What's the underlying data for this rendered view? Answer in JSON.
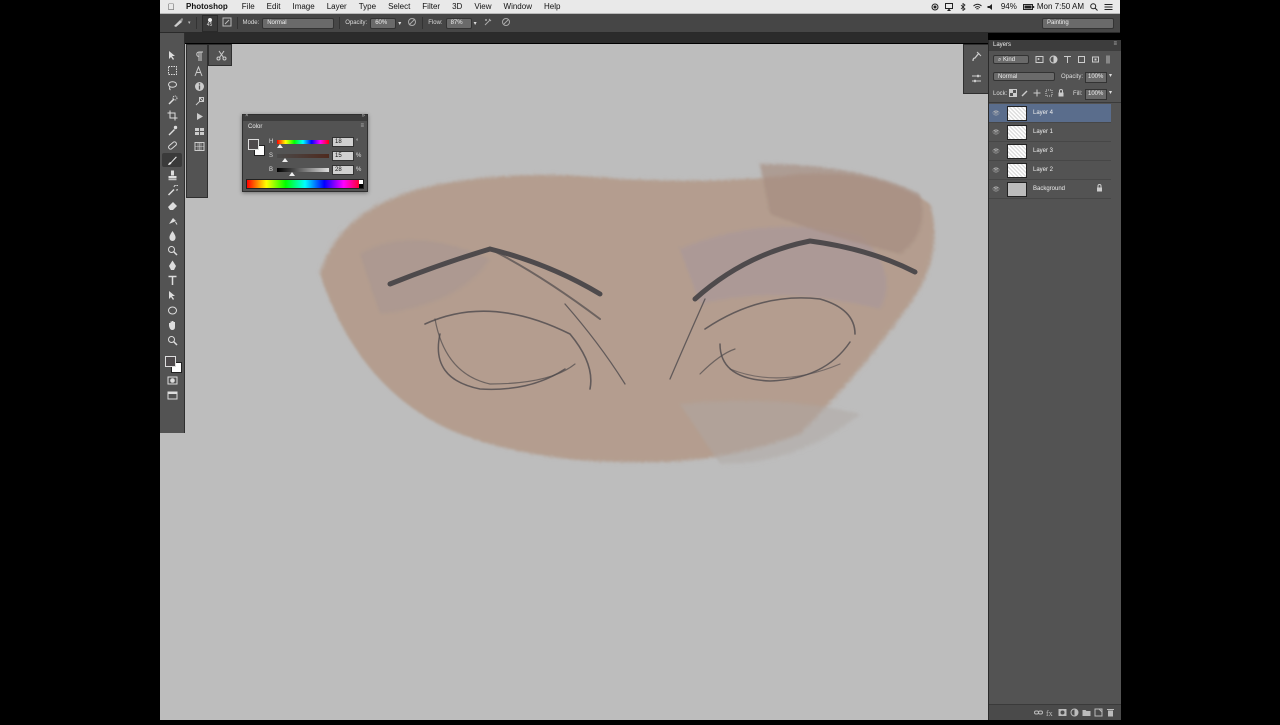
{
  "menubar": {
    "app_name": "Photoshop",
    "menus": [
      "File",
      "Edit",
      "Image",
      "Layer",
      "Type",
      "Select",
      "Filter",
      "3D",
      "View",
      "Window",
      "Help"
    ],
    "battery": "94%",
    "clock": "Mon 7:50 AM"
  },
  "options_bar": {
    "brush_size": "45",
    "mode_label": "Mode:",
    "mode_value": "Normal",
    "opacity_label": "Opacity:",
    "opacity_value": "60%",
    "flow_label": "Flow:",
    "flow_value": "87%",
    "workspace": "Painting"
  },
  "color_panel": {
    "title": "Color",
    "sliders": [
      {
        "label": "H",
        "value": "18",
        "unit": "°",
        "fraction": 0.05
      },
      {
        "label": "S",
        "value": "15",
        "unit": "%",
        "fraction": 0.15
      },
      {
        "label": "B",
        "value": "28",
        "unit": "%",
        "fraction": 0.28
      }
    ]
  },
  "layers_panel": {
    "tab": "Layers",
    "filter_kind": "Kind",
    "blend_mode": "Normal",
    "opacity_label": "Opacity:",
    "opacity_value": "100%",
    "lock_label": "Lock:",
    "fill_label": "Fill:",
    "fill_value": "100%",
    "layers": [
      {
        "name": "Layer 4",
        "selected": true
      },
      {
        "name": "Layer 1",
        "selected": false
      },
      {
        "name": "Layer 3",
        "selected": false
      },
      {
        "name": "Layer 2",
        "selected": false
      },
      {
        "name": "Background",
        "selected": false,
        "locked": true
      }
    ]
  },
  "colors": {
    "canvas": "#bdbdbd",
    "panel": "#535353",
    "skin": "#b39a8a",
    "selected_layer": "#5a6d8c"
  }
}
